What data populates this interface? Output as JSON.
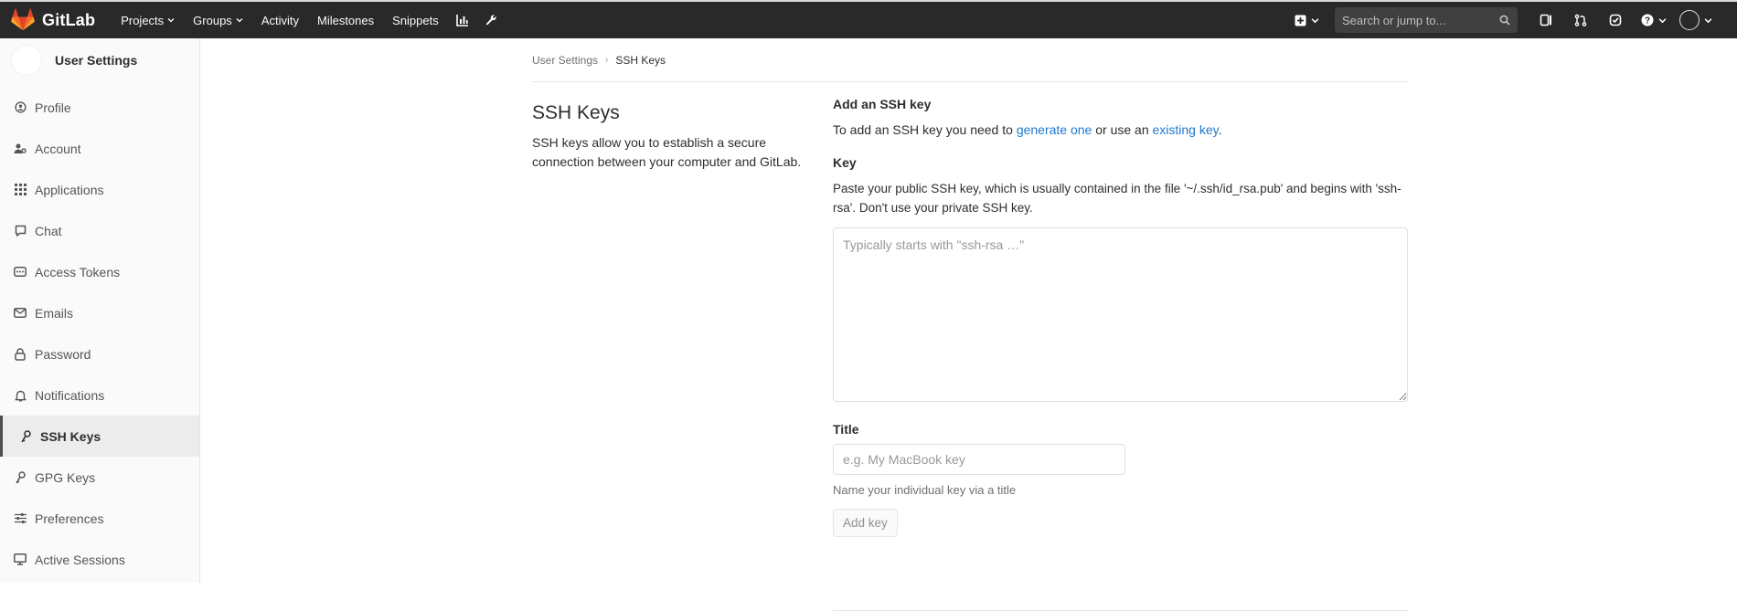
{
  "topbar": {
    "brand": "GitLab",
    "nav": [
      {
        "label": "Projects",
        "dropdown": true
      },
      {
        "label": "Groups",
        "dropdown": true
      },
      {
        "label": "Activity",
        "dropdown": false
      },
      {
        "label": "Milestones",
        "dropdown": false
      },
      {
        "label": "Snippets",
        "dropdown": false
      }
    ],
    "search_placeholder": "Search or jump to...",
    "icons": [
      "chart-icon",
      "wrench-icon",
      "plus-square-icon",
      "issues-icon",
      "merge-request-icon",
      "todo-icon",
      "help-icon",
      "user-avatar"
    ]
  },
  "sidebar": {
    "title": "User Settings",
    "items": [
      {
        "label": "Profile",
        "icon": "profile-icon"
      },
      {
        "label": "Account",
        "icon": "account-icon"
      },
      {
        "label": "Applications",
        "icon": "applications-icon"
      },
      {
        "label": "Chat",
        "icon": "chat-icon"
      },
      {
        "label": "Access Tokens",
        "icon": "token-icon"
      },
      {
        "label": "Emails",
        "icon": "mail-icon"
      },
      {
        "label": "Password",
        "icon": "lock-icon"
      },
      {
        "label": "Notifications",
        "icon": "bell-icon"
      },
      {
        "label": "SSH Keys",
        "icon": "key-icon",
        "active": true
      },
      {
        "label": "GPG Keys",
        "icon": "key-icon"
      },
      {
        "label": "Preferences",
        "icon": "sliders-icon"
      },
      {
        "label": "Active Sessions",
        "icon": "monitor-icon"
      }
    ]
  },
  "breadcrumb": {
    "parent": "User Settings",
    "current": "SSH Keys"
  },
  "page": {
    "title": "SSH Keys",
    "description": "SSH keys allow you to establish a secure connection between your computer and GitLab."
  },
  "form": {
    "section_title": "Add an SSH key",
    "intro_before": "To add an SSH key you need to ",
    "intro_link1": "generate one",
    "intro_middle": " or use an ",
    "intro_link2": "existing key",
    "intro_after": ".",
    "key_label": "Key",
    "key_help": "Paste your public SSH key, which is usually contained in the file '~/.ssh/id_rsa.pub' and begins with 'ssh-rsa'. Don't use your private SSH key.",
    "key_placeholder": "Typically starts with \"ssh-rsa …\"",
    "title_label": "Title",
    "title_placeholder": "e.g. My MacBook key",
    "title_help": "Name your individual key via a title",
    "submit_label": "Add key"
  },
  "colors": {
    "topbar": "#292929",
    "link": "#1f78d1",
    "sidebar_bg": "#fafafa",
    "logo_orange": "#fc6d26"
  }
}
